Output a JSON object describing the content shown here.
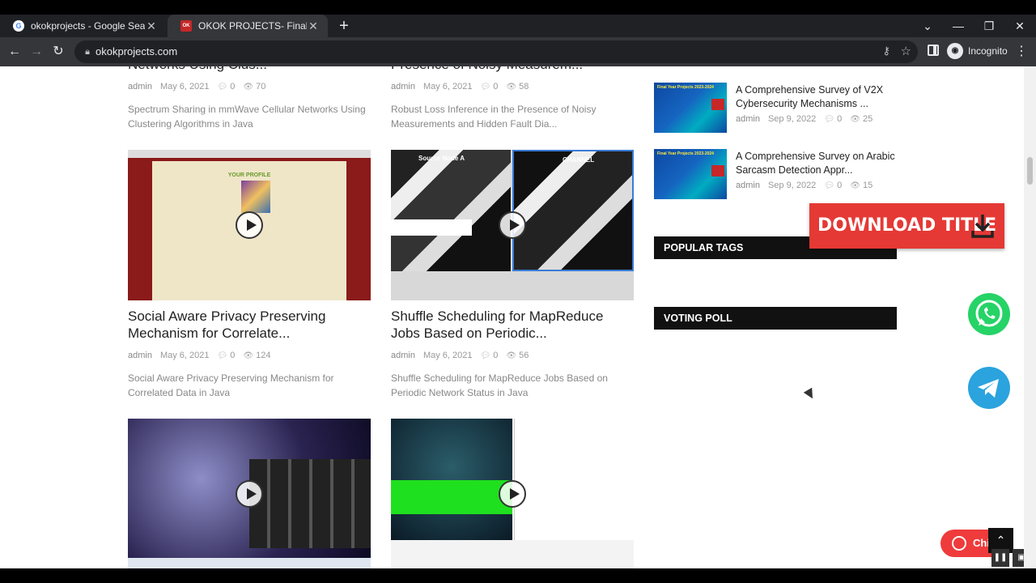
{
  "browser": {
    "tabs": [
      {
        "title": "okokprojects - Google Search",
        "favicon": "google-icon",
        "active": false
      },
      {
        "title": "OKOK PROJECTS- Final Year Proj",
        "favicon": "okok-icon",
        "active": true
      }
    ],
    "url": "okokprojects.com",
    "profile_label": "Incognito"
  },
  "posts": {
    "top_row": [
      {
        "title_fragment": "Networks Using Clus...",
        "author": "admin",
        "date": "May 6, 2021",
        "comments": "0",
        "views": "70",
        "excerpt": "Spectrum Sharing in mmWave Cellular Networks Using Clustering Algorithms in Java"
      },
      {
        "title_fragment": "Presence of Noisy Measurem...",
        "author": "admin",
        "date": "May 6, 2021",
        "comments": "0",
        "views": "58",
        "excerpt": "Robust Loss Inference in the Presence of Noisy Measurements and Hidden Fault Dia..."
      }
    ],
    "middle_row": [
      {
        "title": "Social Aware Privacy Preserving Mechanism for Correlate...",
        "author": "admin",
        "date": "May 6, 2021",
        "comments": "0",
        "views": "124",
        "excerpt": "Social Aware Privacy Preserving Mechanism for Correlated Data in Java",
        "image_caption": "YOUR PROFILE"
      },
      {
        "title": "Shuffle Scheduling for MapReduce Jobs Based on Periodic...",
        "author": "admin",
        "date": "May 6, 2021",
        "comments": "0",
        "views": "56",
        "excerpt": "Shuffle Scheduling for MapReduce Jobs Based on Periodic Network Status in Java",
        "image_caption_left": "Source Node A",
        "image_caption_right": "CHANNEL"
      }
    ]
  },
  "sidebar": {
    "recent": [
      {
        "title": "A Comprehensive Survey of V2X Cybersecurity Mechanisms ...",
        "author": "admin",
        "date": "Sep 9, 2022",
        "comments": "0",
        "views": "25"
      },
      {
        "title": "A Comprehensive Survey on Arabic Sarcasm Detection Appr...",
        "author": "admin",
        "date": "Sep 9, 2022",
        "comments": "0",
        "views": "15"
      }
    ],
    "thumb_banner": "Final Year Projects 2023-2024",
    "popular_tags_heading": "POPULAR TAGS",
    "voting_poll_heading": "VOTING POLL"
  },
  "floating": {
    "download_label": "DOWNLOAD TITLE",
    "chat_label": "Chi"
  },
  "colors": {
    "accent_red": "#e53935",
    "whatsapp": "#25d366",
    "telegram": "#2aa3de",
    "widget_header": "#111111"
  }
}
